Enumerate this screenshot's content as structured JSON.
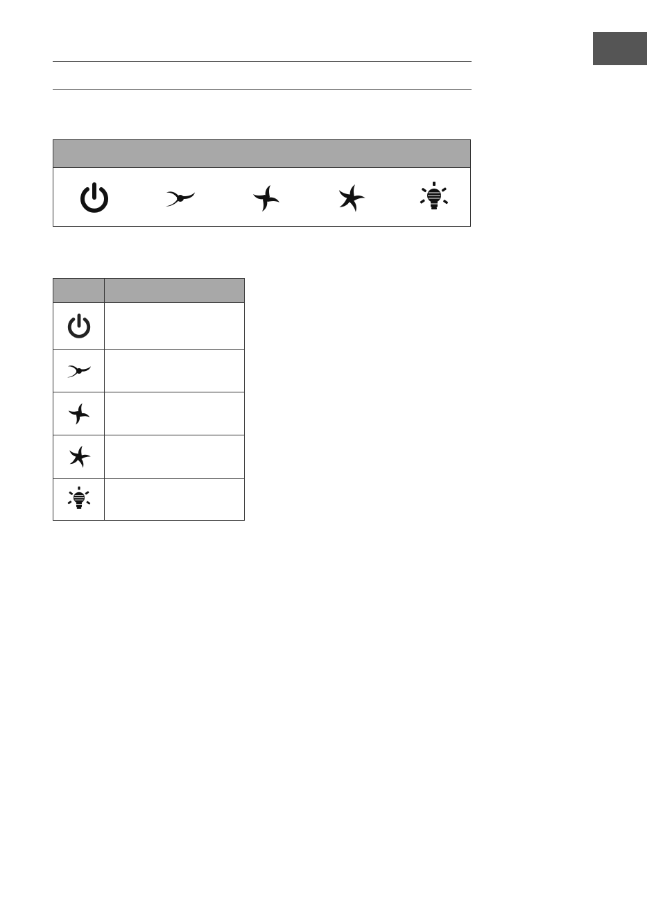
{
  "page": {
    "lang_tab_color": "#555555"
  },
  "control_panel": {
    "header_color": "#a8a8a8",
    "buttons": [
      {
        "icon": "power-icon"
      },
      {
        "icon": "fan-speed-low-icon"
      },
      {
        "icon": "fan-speed-medium-icon"
      },
      {
        "icon": "fan-speed-high-icon"
      },
      {
        "icon": "light-bulb-icon"
      }
    ]
  },
  "legend": {
    "header": {
      "col_symbol": "",
      "col_function": ""
    },
    "rows": [
      {
        "icon": "power-icon",
        "description": ""
      },
      {
        "icon": "fan-speed-low-icon",
        "description": ""
      },
      {
        "icon": "fan-speed-medium-icon",
        "description": ""
      },
      {
        "icon": "fan-speed-high-icon",
        "description": ""
      },
      {
        "icon": "light-bulb-icon",
        "description": ""
      }
    ]
  }
}
